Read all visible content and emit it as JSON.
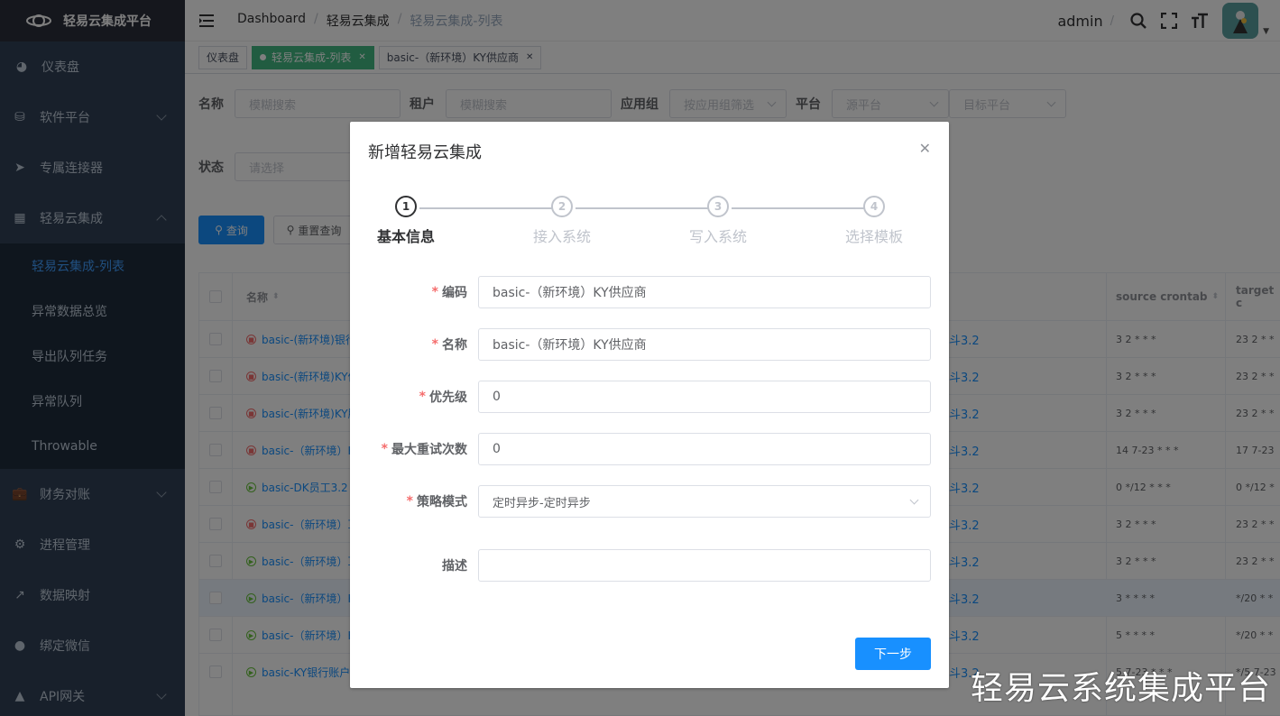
{
  "app": {
    "title": "轻易云集成平台"
  },
  "sidebar": {
    "items": [
      {
        "label": "仪表盘",
        "icon": "dashboard-icon"
      },
      {
        "label": "软件平台",
        "icon": "database-icon"
      },
      {
        "label": "专属连接器",
        "icon": "send-icon"
      },
      {
        "label": "轻易云集成",
        "icon": "grid-icon",
        "expanded": true
      },
      {
        "label": "财务对账",
        "icon": "money-icon"
      },
      {
        "label": "进程管理",
        "icon": "chip-icon"
      },
      {
        "label": "数据映射",
        "icon": "external-link-icon"
      },
      {
        "label": "绑定微信",
        "icon": "wechat-icon"
      },
      {
        "label": "API网关",
        "icon": "api-icon"
      }
    ],
    "subitems": [
      "轻易云集成-列表",
      "异常数据总览",
      "导出队列任务",
      "异常队列",
      "Throwable"
    ]
  },
  "navbar": {
    "breadcrumbs": [
      "Dashboard",
      "轻易云集成",
      "轻易云集成-列表"
    ],
    "user": "admin"
  },
  "tags": [
    "仪表盘",
    "轻易云集成-列表",
    "basic-（新环境）KY供应商"
  ],
  "filters": {
    "name_label": "名称",
    "name_placeholder": "模糊搜索",
    "tenant_label": "租户",
    "tenant_placeholder": "模糊搜索",
    "appgroup_label": "应用组",
    "appgroup_placeholder": "按应用组筛选",
    "platform_label": "平台",
    "source_placeholder": "源平台",
    "target_placeholder": "目标平台",
    "status_label": "状态",
    "status_placeholder": "请选择",
    "search_btn": "查询",
    "reset_btn": "重置查询"
  },
  "table": {
    "headers": {
      "name": "名称",
      "source_crontab": "source crontab",
      "target": "target c"
    },
    "rows": [
      {
        "status": "stop",
        "name": "basic-(新环境)银行",
        "ver": "斗3.2",
        "src": "3 2 * * *",
        "tgt": "23 2 * *"
      },
      {
        "status": "stop",
        "name": "basic-(新环境)KY供",
        "ver": "斗3.2",
        "src": "3 2 * * *",
        "tgt": "23 2 * *"
      },
      {
        "status": "stop",
        "name": "basic-(新环境)KY胆",
        "ver": "斗3.2",
        "src": "3 2 * * *",
        "tgt": "23 2 * *"
      },
      {
        "status": "stop",
        "name": "basic-（新环境）K",
        "ver": "斗3.2",
        "src": "14 7-23 * * *",
        "tgt": "17 7-23"
      },
      {
        "status": "run",
        "name": "basic-DK员工3.2",
        "ver": "斗3.2",
        "src": "0 */12 * * *",
        "tgt": "0 */12 *"
      },
      {
        "status": "stop",
        "name": "basic-（新环境）耳",
        "ver": "斗3.2",
        "src": "3 2 * * *",
        "tgt": "23 2 * *"
      },
      {
        "status": "run",
        "name": "basic-（新环境）耳",
        "ver": "斗3.2",
        "src": "3 2 * * *",
        "tgt": "23 2 * *"
      },
      {
        "status": "run",
        "name": "basic-（新环境）K",
        "ver": "斗3.2",
        "src": "3 * * * *",
        "tgt": "*/20 * *"
      },
      {
        "status": "run",
        "name": "basic-（新环境）K",
        "ver": "斗3.2",
        "src": "5 * * * *",
        "tgt": "*/20 * *"
      },
      {
        "status": "run",
        "name": "basic-KY银行账户",
        "ver": "斗3.2",
        "src": "5 7-23 * * *",
        "tgt": "*/5 7-23"
      }
    ]
  },
  "dialog": {
    "title": "新增轻易云集成",
    "steps": [
      "基本信息",
      "接入系统",
      "写入系统",
      "选择模板"
    ],
    "fields": {
      "code_label": "编码",
      "code_value": "basic-（新环境）KY供应商",
      "name_label": "名称",
      "name_value": "basic-（新环境）KY供应商",
      "priority_label": "优先级",
      "priority_value": "0",
      "retry_label": "最大重试次数",
      "retry_value": "0",
      "strategy_label": "策略模式",
      "strategy_value": "定时异步-定时异步",
      "desc_label": "描述",
      "desc_value": ""
    },
    "next_btn": "下一步"
  },
  "watermark": "轻易云系统集成平台"
}
